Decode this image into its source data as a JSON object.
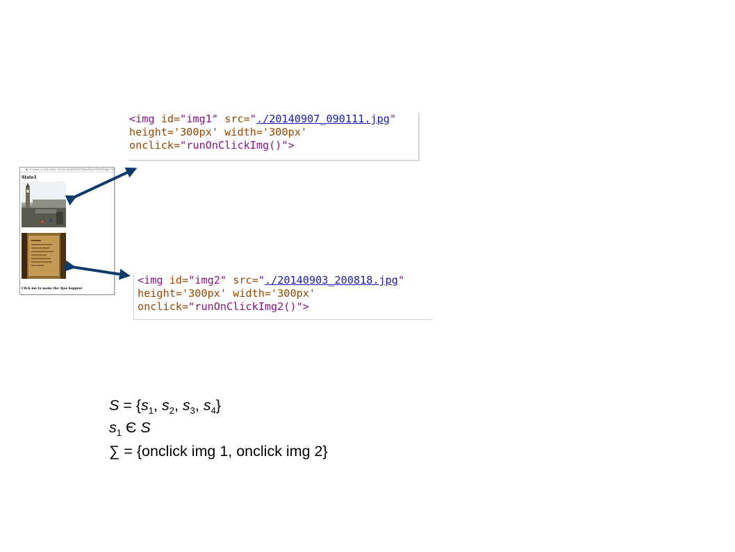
{
  "code_snippet_1": {
    "line1_tag": "<img",
    "line1_id_attr": "id=",
    "line1_id_val": "\"img1\"",
    "line1_src_attr": "src=",
    "line1_src_open": "\"",
    "line1_src_url": "./20140907_090111.jpg",
    "line1_src_close": "\"",
    "line2": "height='300px' width='300px'",
    "line3_attr": "onclick=",
    "line3_val": "\"runOnClickImg()\"",
    "line3_end": ">"
  },
  "code_snippet_2": {
    "line1_tag": "<img",
    "line1_id_attr": "id=",
    "line1_id_val": "\"img2\"",
    "line1_src_attr": "src=",
    "line1_src_open": "\"",
    "line1_src_url": "./20140903_200818.jpg",
    "line1_src_close": "\"",
    "line2": "height='300px' width='300px'",
    "line3_attr": "onclick=",
    "line3_val": "\"runOnClickImg2()\"",
    "line3_end": ">"
  },
  "mock_page": {
    "url_text": "◉ ☰ www.cs.odu.edu/~/jlcase/ajaxTests/Ajax/SaveStatePage.html",
    "state_label": "State1",
    "cta_text": "Click me to make the Ajax happen!"
  },
  "math": {
    "eq1_lhs": "S",
    "eq1_eq": " = {",
    "s": "s",
    "sub1": "1",
    "sub2": "2",
    "sub3": "3",
    "sub4": "4",
    "comma": ", ",
    "close": "}",
    "eq2_member": " Є ",
    "eq2_rhs": "S",
    "eq3": "∑ = {onclick img 1, onclick img 2}"
  },
  "colors": {
    "arrow": "#0b3a6b"
  }
}
